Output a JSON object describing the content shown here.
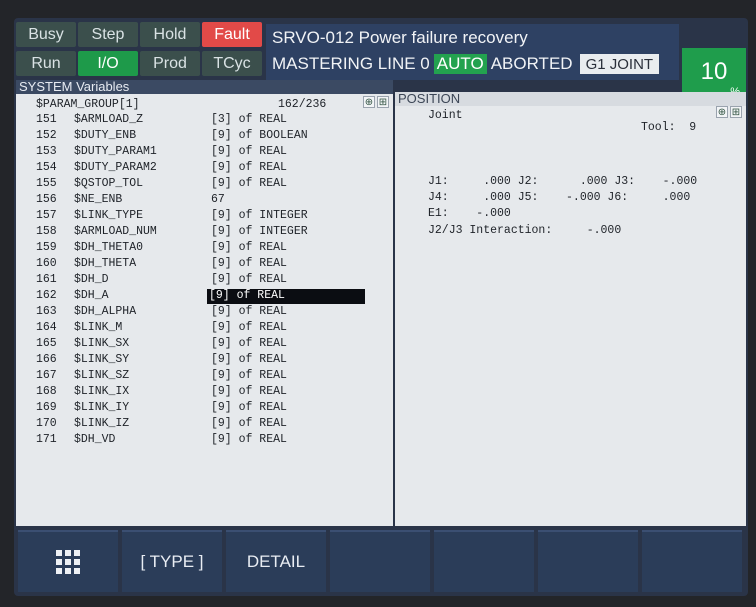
{
  "status_keys": [
    {
      "label": "Busy",
      "state": "off"
    },
    {
      "label": "Step",
      "state": "off"
    },
    {
      "label": "Hold",
      "state": "off"
    },
    {
      "label": "Fault",
      "state": "fault"
    },
    {
      "label": "Run",
      "state": "off"
    },
    {
      "label": "I/O",
      "state": "on"
    },
    {
      "label": "Prod",
      "state": "off"
    },
    {
      "label": "TCyc",
      "state": "off"
    }
  ],
  "message": {
    "line1": "SRVO-012 Power failure recovery",
    "line2_prefix": "MASTERING LINE 0",
    "mode": "AUTO",
    "status": "ABORTED",
    "coord": "G1 JOINT"
  },
  "override": {
    "value": "10",
    "unit": "%"
  },
  "system_vars": {
    "title": "SYSTEM Variables",
    "group": "$PARAM_GROUP[1]",
    "count": "162/236",
    "rows": [
      {
        "num": "151",
        "name": "$ARMLOAD_Z",
        "value": "[3] of REAL"
      },
      {
        "num": "152",
        "name": "$DUTY_ENB",
        "value": "[9] of BOOLEAN"
      },
      {
        "num": "153",
        "name": "$DUTY_PARAM1",
        "value": "[9] of REAL"
      },
      {
        "num": "154",
        "name": "$DUTY_PARAM2",
        "value": "[9] of REAL"
      },
      {
        "num": "155",
        "name": "$QSTOP_TOL",
        "value": "[9] of REAL"
      },
      {
        "num": "156",
        "name": "$NE_ENB",
        "value": "67"
      },
      {
        "num": "157",
        "name": "$LINK_TYPE",
        "value": "[9] of INTEGER"
      },
      {
        "num": "158",
        "name": "$ARMLOAD_NUM",
        "value": "[9] of INTEGER"
      },
      {
        "num": "159",
        "name": "$DH_THETA0",
        "value": "[9] of REAL"
      },
      {
        "num": "160",
        "name": "$DH_THETA",
        "value": "[9] of REAL"
      },
      {
        "num": "161",
        "name": "$DH_D",
        "value": "[9] of REAL"
      },
      {
        "num": "162",
        "name": "$DH_A",
        "value": "[9] of REAL"
      },
      {
        "num": "163",
        "name": "$DH_ALPHA",
        "value": "[9] of REAL"
      },
      {
        "num": "164",
        "name": "$LINK_M",
        "value": "[9] of REAL"
      },
      {
        "num": "165",
        "name": "$LINK_SX",
        "value": "[9] of REAL"
      },
      {
        "num": "166",
        "name": "$LINK_SY",
        "value": "[9] of REAL"
      },
      {
        "num": "167",
        "name": "$LINK_SZ",
        "value": "[9] of REAL"
      },
      {
        "num": "168",
        "name": "$LINK_IX",
        "value": "[9] of REAL"
      },
      {
        "num": "169",
        "name": "$LINK_IY",
        "value": "[9] of REAL"
      },
      {
        "num": "170",
        "name": "$LINK_IZ",
        "value": "[9] of REAL"
      },
      {
        "num": "171",
        "name": "$DH_VD",
        "value": "[9] of REAL"
      }
    ],
    "selected_index": 11
  },
  "position": {
    "title": "POSITION",
    "frame": "Joint",
    "tool": "Tool:  9",
    "row1": "J1:     .000 J2:      .000 J3:    -.000",
    "row2": "J4:     .000 J5:    -.000 J6:     .000",
    "row3": "E1:    -.000",
    "interaction": "J2/J3 Interaction:     -.000"
  },
  "function_keys": [
    {
      "label": "",
      "icon": "grid-menu-icon"
    },
    {
      "label": "[ TYPE ]"
    },
    {
      "label": "DETAIL"
    },
    {
      "label": ""
    },
    {
      "label": ""
    },
    {
      "label": ""
    },
    {
      "label": ""
    }
  ]
}
